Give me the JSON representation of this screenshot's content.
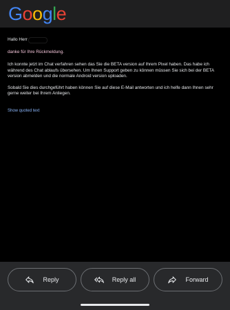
{
  "logo": {
    "letters": [
      "G",
      "o",
      "o",
      "g",
      "l",
      "e"
    ],
    "colors": [
      "#4285F4",
      "#EA4335",
      "#FBBC05",
      "#4285F4",
      "#34A853",
      "#EA4335"
    ]
  },
  "email": {
    "greeting": "Hallo Herr",
    "thanks": "danke für Ihre Rückmeldung.",
    "paragraph1": "Ich konnte jetzt im Chat verfahren sehen das Sie die BETA version auf Ihrem Pixel haben. Das habe ich während des Chat ablaufs übersehen. Um Ihnen Support geben zu können müssen Sie sich bei der BETA version abmelden und die normale Android version uploaden.",
    "paragraph2": "Sobald Sie dies durchgeführt haben können Sie auf diese E-Mail antworten und ich helfe dann Ihnen sehr gerne weiter bei Ihrem Anliegen.",
    "show_quoted": "Show quoted text"
  },
  "actions": {
    "reply": "Reply",
    "reply_all": "Reply all",
    "forward": "Forward"
  },
  "icons": {
    "reply": "reply-icon",
    "reply_all": "reply-all-icon",
    "forward": "forward-icon"
  }
}
